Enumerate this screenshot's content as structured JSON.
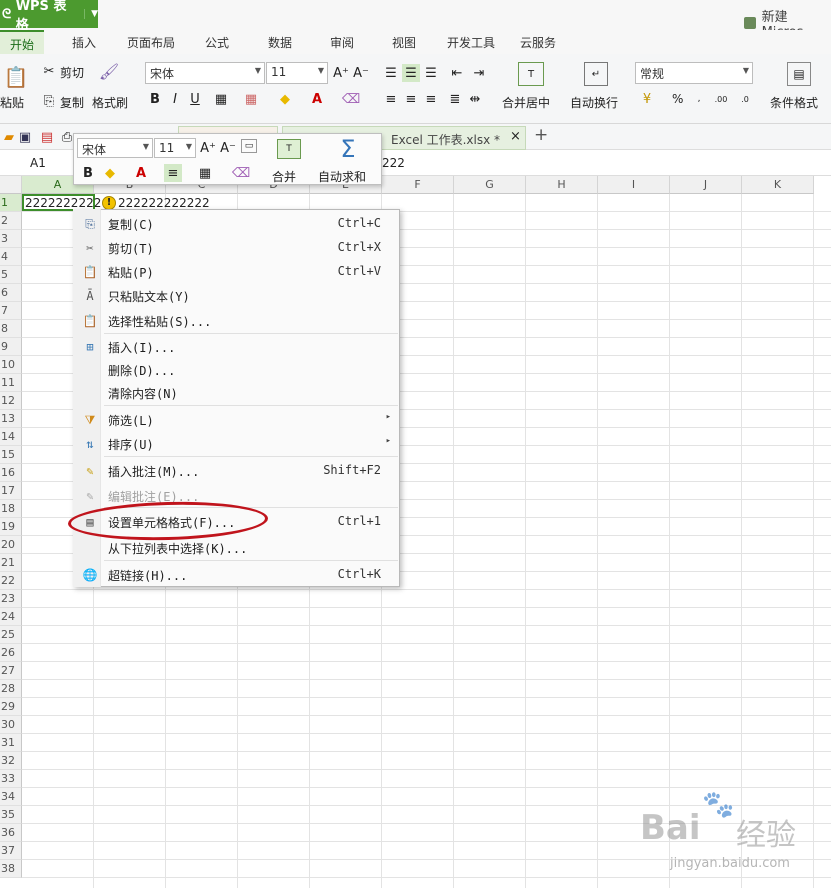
{
  "app": {
    "name": "WPS 表格",
    "doc_title": "新建 Micros"
  },
  "tabs": [
    "开始",
    "插入",
    "页面布局",
    "公式",
    "数据",
    "审阅",
    "视图",
    "开发工具",
    "云服务"
  ],
  "ribbon": {
    "paste": "粘贴",
    "cut": "剪切",
    "copy": "复制",
    "format_painter": "格式刷",
    "font": "宋体",
    "size": "11",
    "merge": "合并居中",
    "wrap": "自动换行",
    "number_format": "常规",
    "percent": "%",
    "conditional": "条件格式"
  },
  "quickbar": {
    "tab_text": "Excel 工作表.xlsx *",
    "close": "×",
    "add": "+"
  },
  "formula": {
    "namebox": "A1",
    "value": "222"
  },
  "sheet": {
    "columns": [
      "A",
      "B",
      "C",
      "D",
      "E",
      "F",
      "G",
      "H",
      "I",
      "J",
      "K"
    ],
    "rows": [
      "1",
      "2",
      "3",
      "4",
      "5",
      "6",
      "7",
      "8",
      "9",
      "10",
      "11",
      "12",
      "13",
      "14",
      "15",
      "16",
      "17",
      "18",
      "19",
      "20",
      "21",
      "22",
      "23",
      "24",
      "25",
      "26",
      "27",
      "28",
      "29",
      "30",
      "31",
      "32",
      "33",
      "34",
      "35",
      "36",
      "37",
      "38"
    ],
    "a1": "2222222222",
    "b1": "222222222222"
  },
  "minitb": {
    "font": "宋体",
    "size": "11",
    "merge": "合并",
    "autosum": "自动求和"
  },
  "menu": [
    {
      "label": "复制(C)",
      "shortcut": "Ctrl+C",
      "icon": "copy-icon"
    },
    {
      "label": "剪切(T)",
      "shortcut": "Ctrl+X",
      "icon": "cut-icon"
    },
    {
      "label": "粘贴(P)",
      "shortcut": "Ctrl+V",
      "icon": "paste-icon"
    },
    {
      "label": "只粘贴文本(Y)",
      "shortcut": "",
      "icon": "paste-text-icon"
    },
    {
      "label": "选择性粘贴(S)...",
      "shortcut": "",
      "icon": "paste-special-icon"
    },
    {
      "label": "插入(I)...",
      "shortcut": "",
      "icon": "insert-icon"
    },
    {
      "label": "删除(D)...",
      "shortcut": "",
      "icon": ""
    },
    {
      "label": "清除内容(N)",
      "shortcut": "",
      "icon": ""
    },
    {
      "label": "筛选(L)",
      "shortcut": "",
      "icon": "filter-icon",
      "submenu": "▸"
    },
    {
      "label": "排序(U)",
      "shortcut": "",
      "icon": "sort-icon",
      "submenu": "▸"
    },
    {
      "label": "插入批注(M)...",
      "shortcut": "Shift+F2",
      "icon": "comment-icon"
    },
    {
      "label": "编辑批注(E)...",
      "shortcut": "",
      "icon": "edit-comment-icon"
    },
    {
      "label": "设置单元格格式(F)...",
      "shortcut": "Ctrl+1",
      "icon": "format-cells-icon"
    },
    {
      "label": "从下拉列表中选择(K)...",
      "shortcut": "",
      "icon": ""
    },
    {
      "label": "超链接(H)...",
      "shortcut": "Ctrl+K",
      "icon": "hyperlink-icon"
    }
  ],
  "watermark": {
    "brand": "Bai",
    "brand2": "经验",
    "url": "jingyan.baidu.com"
  }
}
